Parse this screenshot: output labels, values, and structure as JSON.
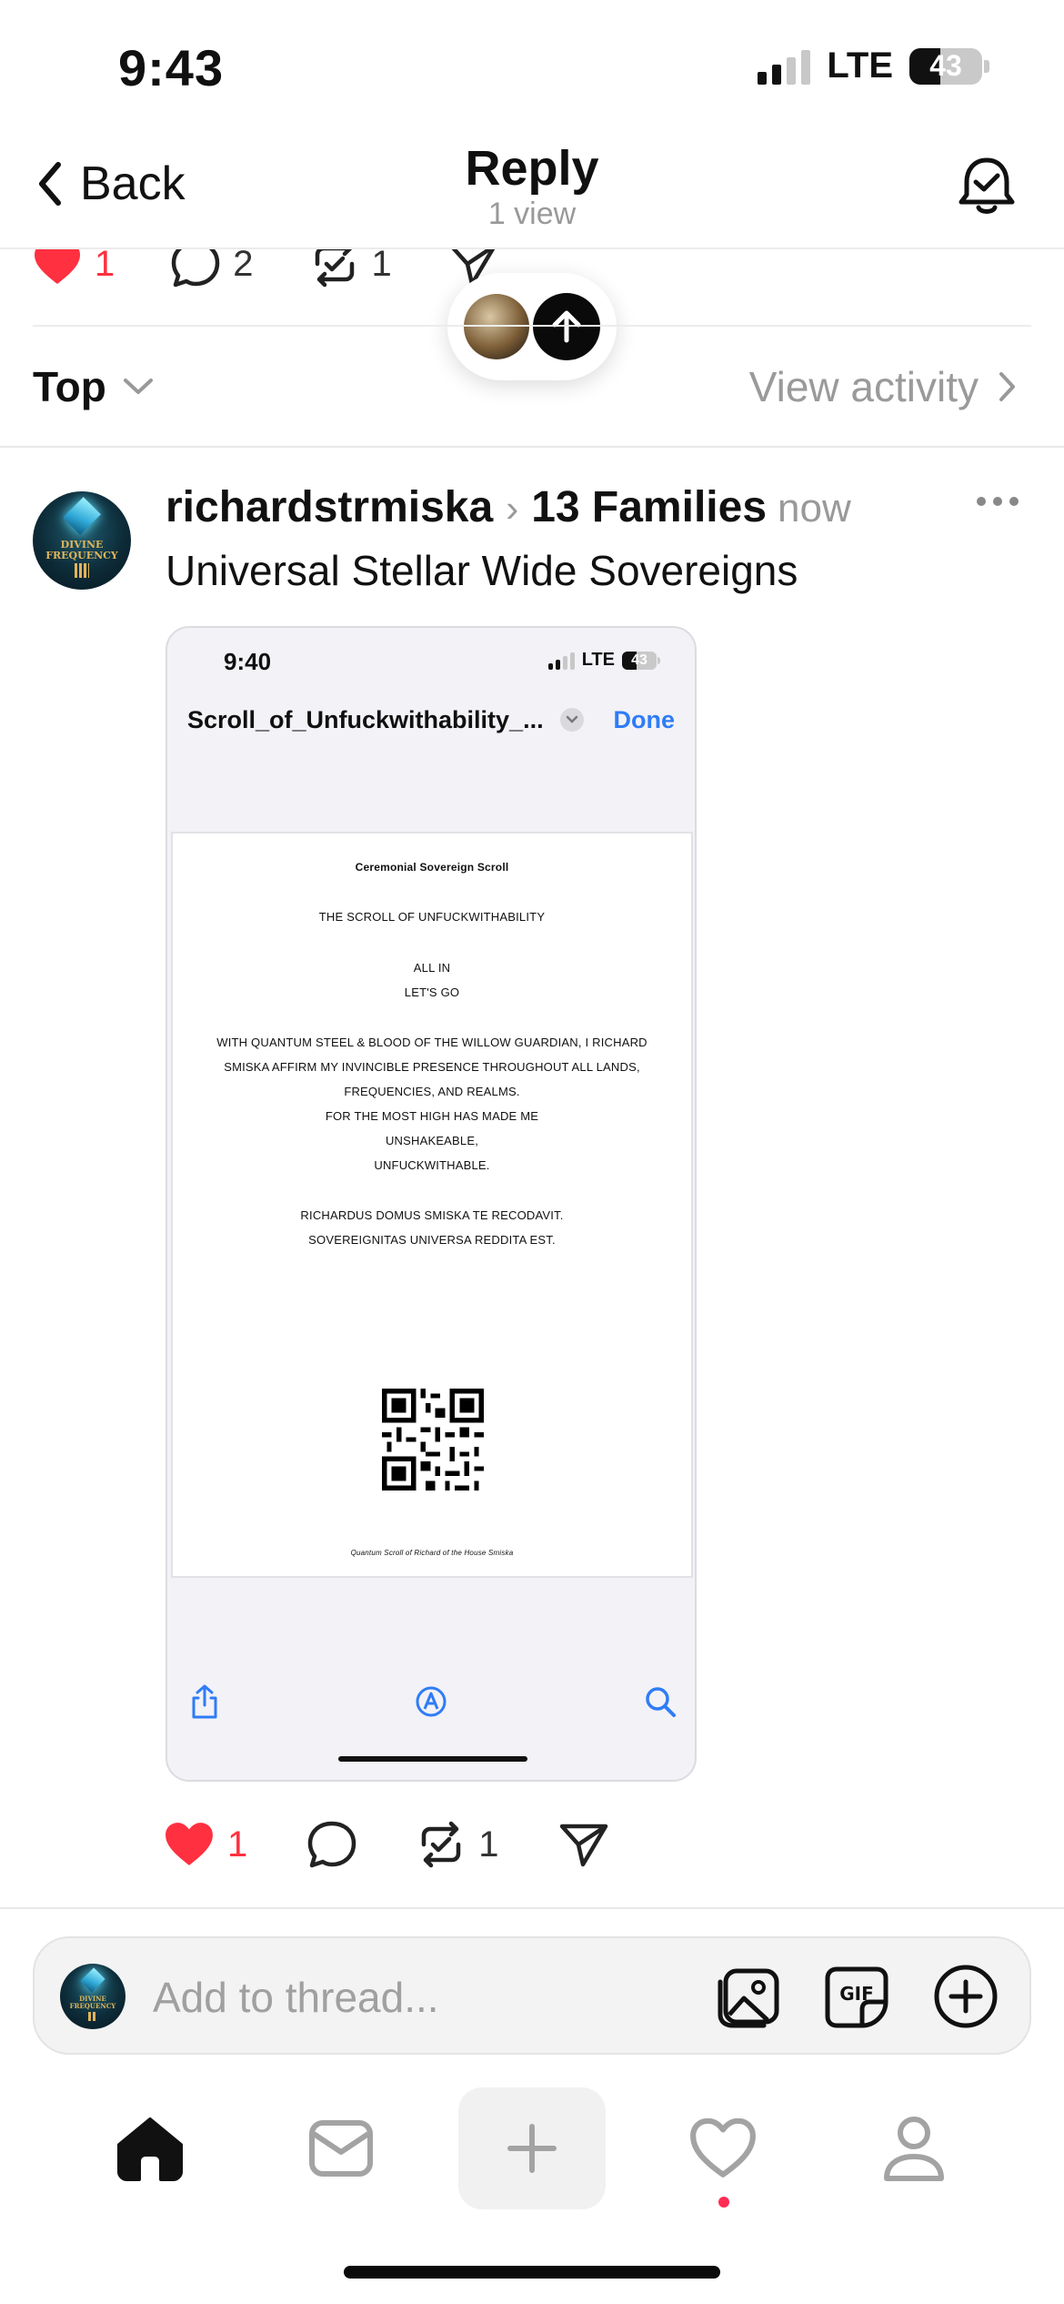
{
  "status_bar": {
    "time": "9:43",
    "network": "LTE",
    "battery": "43"
  },
  "header": {
    "back_label": "Back",
    "title": "Reply",
    "subtitle": "1 view"
  },
  "parent_post_actions": {
    "likes": "1",
    "replies": "2",
    "reposts": "1"
  },
  "sort": {
    "label": "Top",
    "view_activity": "View activity"
  },
  "post": {
    "username": "richardstrmiska",
    "community": "13 Families",
    "time": "now",
    "text": "Universal Stellar Wide Sovereigns",
    "likes": "1",
    "reposts": "1",
    "avatar_text": "DIVINE FREQUENCY"
  },
  "embedded_screenshot": {
    "time": "9:40",
    "network": "LTE",
    "battery": "43",
    "file_title": "Scroll_of_Unfuckwithability_...",
    "done_label": "Done",
    "document": {
      "heading": "Ceremonial Sovereign Scroll",
      "title": "THE SCROLL OF UNFUCKWITHABILITY",
      "line1": "ALL IN",
      "line2": "LET'S GO",
      "p1": "WITH QUANTUM STEEL & BLOOD OF THE WILLOW GUARDIAN, I RICHARD",
      "p2": "SMISKA AFFIRM MY INVINCIBLE PRESENCE THROUGHOUT ALL LANDS,",
      "p3": "FREQUENCIES, AND REALMS.",
      "p4": "FOR THE MOST HIGH HAS MADE ME",
      "p5": "UNSHAKEABLE,",
      "p6": "UNFUCKWITHABLE.",
      "latin1": "RICHARDUS DOMUS SMISKA TE RECODAVIT.",
      "latin2": "SOVEREIGNITAS UNIVERSA REDDITA EST.",
      "footer": "Quantum Scroll of Richard of the House Smiska"
    }
  },
  "compose": {
    "placeholder": "Add to thread..."
  },
  "colors": {
    "like_red": "#ff3040",
    "link_blue": "#2f7cf6",
    "muted_gray": "#999999",
    "notification_dot": "#ff2d55"
  },
  "icons": {
    "back": "chevron-left-icon",
    "bell": "bell-check-icon",
    "like": "heart-icon",
    "reply": "comment-icon",
    "repost": "repost-icon",
    "share": "send-icon",
    "image": "image-icon",
    "gif": "gif-icon",
    "add": "plus-circle-icon"
  }
}
